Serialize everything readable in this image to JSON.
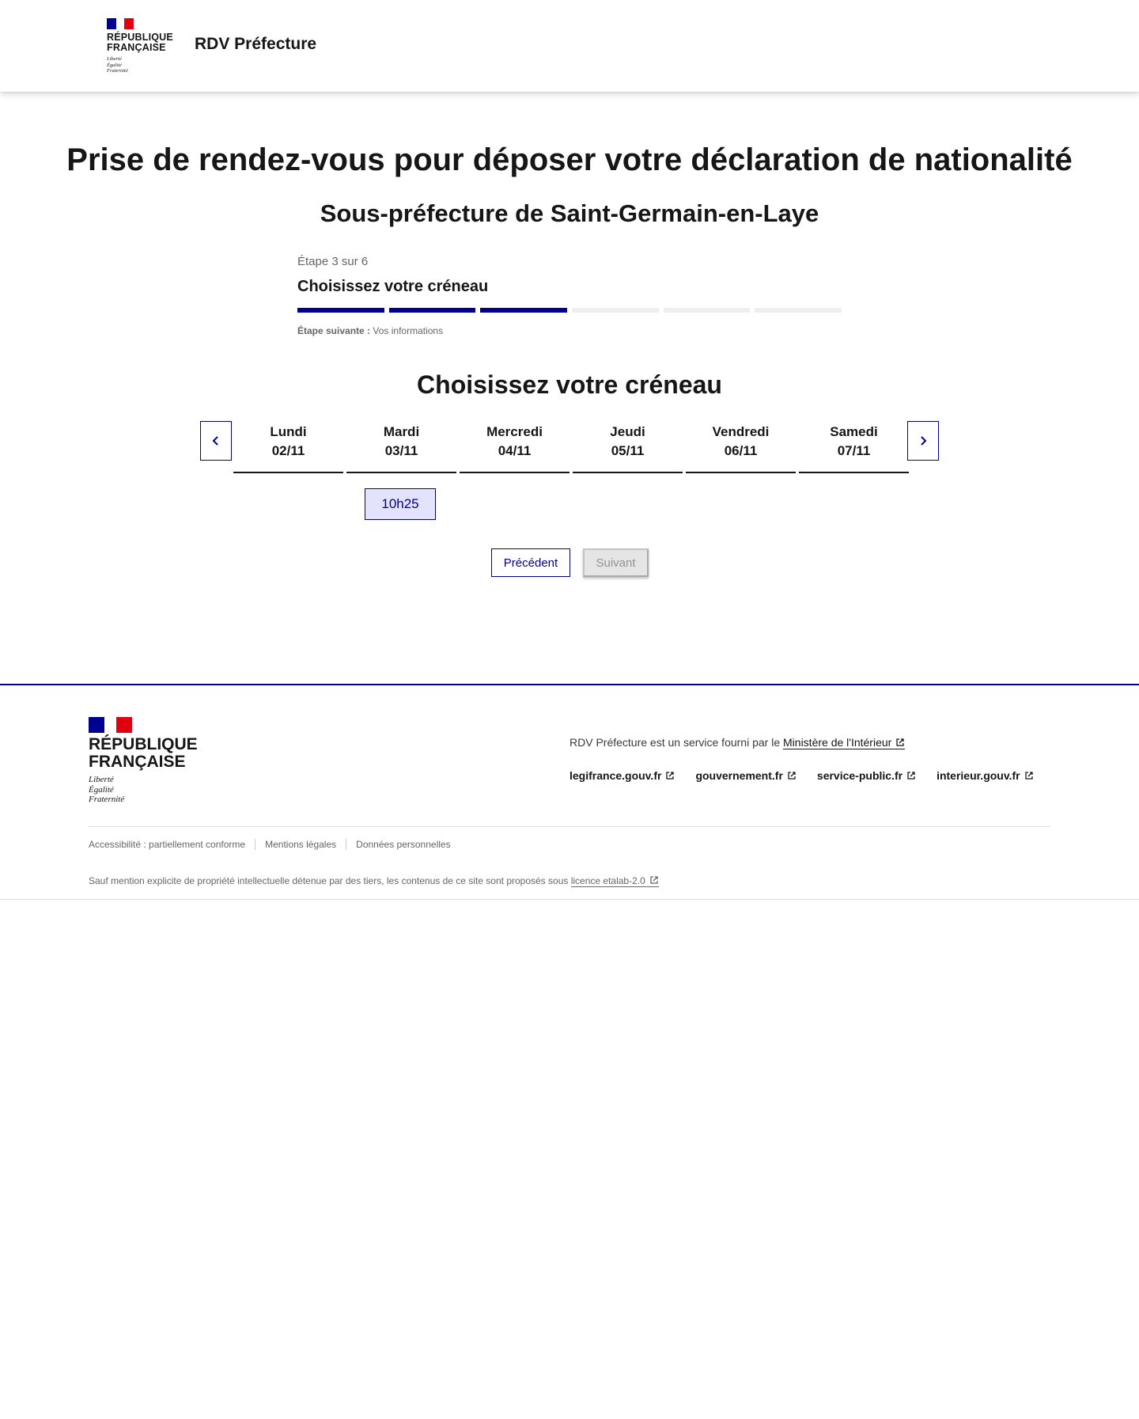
{
  "header": {
    "logo_line1": "RÉPUBLIQUE",
    "logo_line2": "FRANÇAISE",
    "motto1": "Liberté",
    "motto2": "Égalité",
    "motto3": "Fraternité",
    "service_name": "RDV Préfecture"
  },
  "main": {
    "title": "Prise de rendez-vous pour déposer votre déclaration de nationalité",
    "subtitle": "Sous-préfecture de Saint-Germain-en-Laye",
    "stepper": {
      "state": "Étape 3 sur 6",
      "current_step": "Choisissez votre créneau",
      "total_steps": 6,
      "completed_steps": 3,
      "next_label": "Étape suivante :",
      "next_step": "Vos informations"
    },
    "slot_title": "Choisissez votre créneau",
    "days": [
      {
        "name": "Lundi",
        "date": "02/11"
      },
      {
        "name": "Mardi",
        "date": "03/11"
      },
      {
        "name": "Mercredi",
        "date": "04/11"
      },
      {
        "name": "Jeudi",
        "date": "05/11"
      },
      {
        "name": "Vendredi",
        "date": "06/11"
      },
      {
        "name": "Samedi",
        "date": "07/11"
      }
    ],
    "slots": [
      {
        "day": "Mardi 03/11",
        "time": "10h25"
      }
    ],
    "buttons": {
      "previous": "Précédent",
      "next": "Suivant"
    }
  },
  "footer": {
    "logo_line1": "RÉPUBLIQUE",
    "logo_line2": "FRANÇAISE",
    "motto1": "Liberté",
    "motto2": "Égalité",
    "motto3": "Fraternité",
    "desc_text": "RDV Préfecture est un service fourni par le ",
    "desc_link": "Ministère de l'Intérieur",
    "links": [
      "legifrance.gouv.fr",
      "gouvernement.fr",
      "service-public.fr",
      "interieur.gouv.fr"
    ],
    "bottom_links": [
      "Accessibilité : partiellement conforme",
      "Mentions légales",
      "Données personnelles"
    ],
    "license_text": "Sauf mention explicite de propriété intellectuelle détenue par des tiers, les contenus de ce site sont proposés sous ",
    "license_link": "licence etalab-2.0"
  },
  "colors": {
    "primary": "#000091",
    "flag_red": "#e1000f",
    "slot_bg": "#e3e3fd",
    "disabled_bg": "#e5e5e5"
  },
  "icons": {
    "prev": "chevron-left-icon",
    "next": "chevron-right-icon",
    "external": "external-link-icon"
  }
}
